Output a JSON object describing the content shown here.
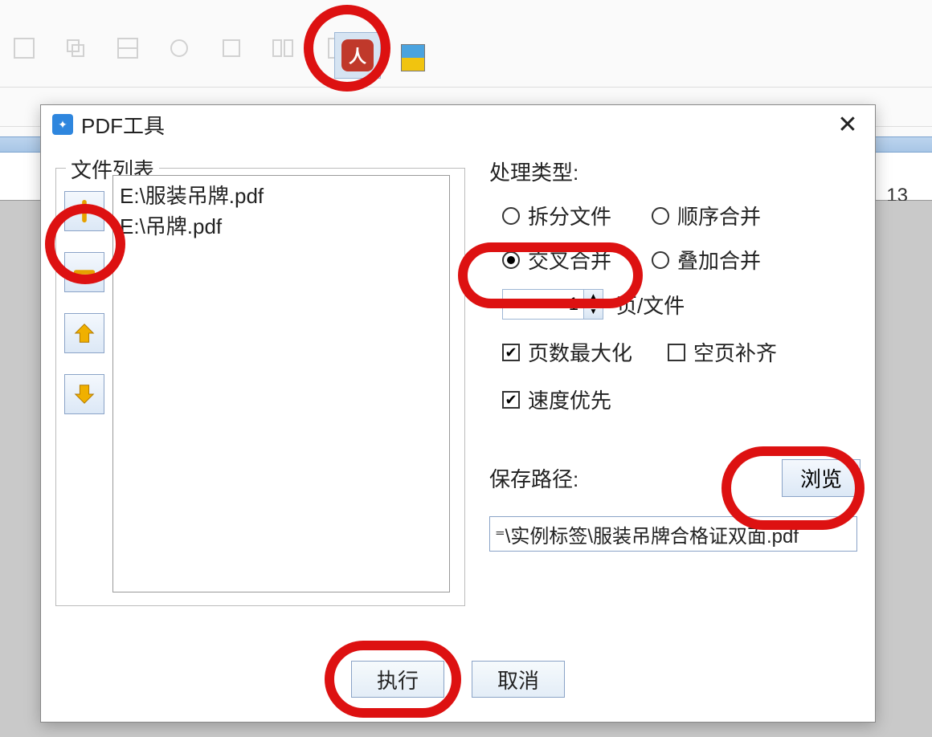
{
  "ruler_mark": "13",
  "dialog": {
    "title": "PDF工具",
    "file_list": {
      "legend": "文件列表",
      "items": [
        "E:\\服装吊牌.pdf",
        "E:\\吊牌.pdf"
      ]
    },
    "process": {
      "label": "处理类型:",
      "options": {
        "split": "拆分文件",
        "seq_merge": "顺序合并",
        "cross_merge": "交叉合并",
        "overlay_merge": "叠加合并"
      },
      "selected": "cross_merge",
      "pages_value": "1",
      "pages_unit": "页/文件",
      "max_pages": "页数最大化",
      "blank_fill": "空页补齐",
      "speed_first": "速度优先"
    },
    "save": {
      "label": "保存路径:",
      "browse": "浏览",
      "path": "⁼\\实例标签\\服装吊牌合格证双面.pdf"
    },
    "buttons": {
      "execute": "执行",
      "cancel": "取消"
    }
  }
}
